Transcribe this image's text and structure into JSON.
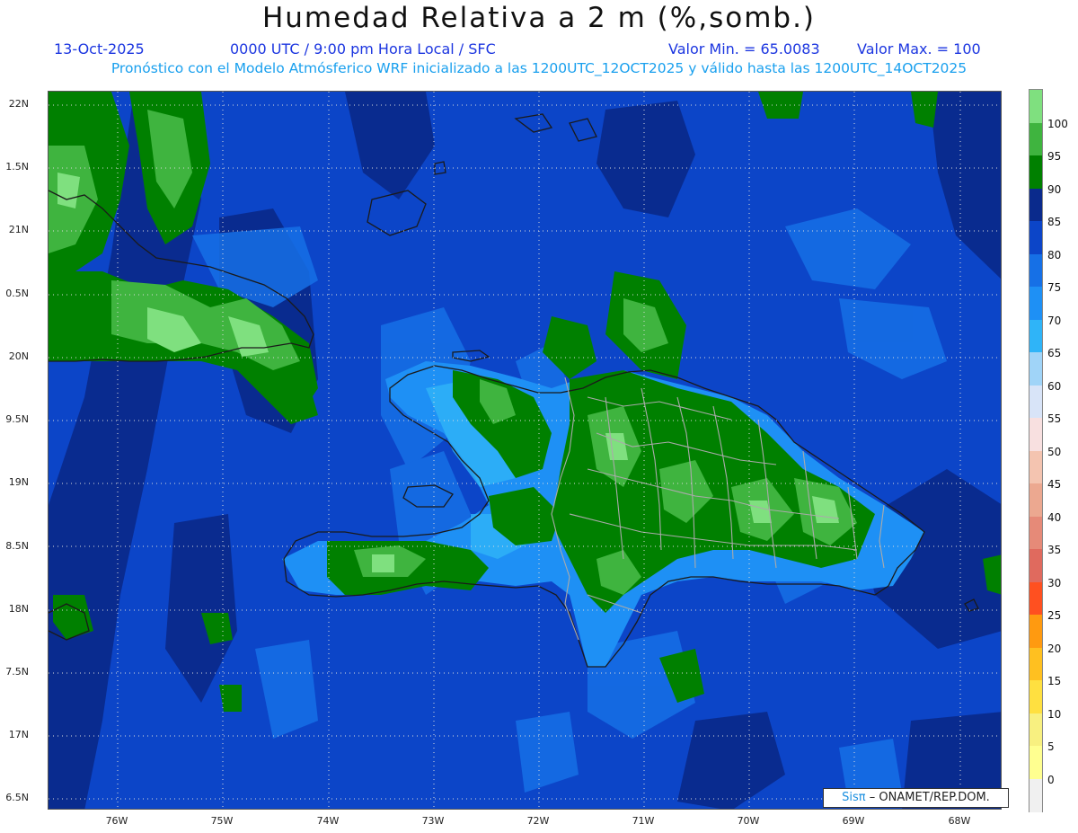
{
  "header": {
    "title": "Humedad Relativa a 2 m (%,somb.)",
    "date": "13-Oct-2025",
    "time": "0000 UTC / 9:00 pm Hora Local / SFC",
    "min_label": "Valor Min. = 65.0083",
    "max_label": "Valor Max. = 100",
    "description": "Pronóstico con el Modelo Atmósferico WRF inicializado a las 1200UTC_12OCT2025 y válido hasta las  1200UTC_14OCT2025"
  },
  "axes": {
    "lat_labels": [
      "22N",
      "1.5N",
      "21N",
      "0.5N",
      "20N",
      "9.5N",
      "19N",
      "8.5N",
      "18N",
      "7.5N",
      "17N",
      "6.5N"
    ],
    "lon_labels": [
      "76W",
      "75W",
      "74W",
      "73W",
      "72W",
      "71W",
      "70W",
      "69W",
      "68W"
    ]
  },
  "colorbar": {
    "labels": [
      "100",
      "95",
      "90",
      "85",
      "80",
      "75",
      "70",
      "65",
      "60",
      "55",
      "50",
      "45",
      "40",
      "35",
      "30",
      "25",
      "20",
      "15",
      "10",
      "5",
      "0"
    ],
    "colors": [
      "#7fe07f",
      "#3fb43f",
      "#008000",
      "#0a2a8c",
      "#0c45c8",
      "#1670e6",
      "#1e90f5",
      "#2fb4f8",
      "#a0d4f8",
      "#d8e4f8",
      "#f8e0e0",
      "#f4c4b0",
      "#eca890",
      "#e68a78",
      "#e06a5e",
      "#ff5020",
      "#ff9a10",
      "#ffc020",
      "#ffe040",
      "#f8f080",
      "#ffff90",
      "#f0f0f0"
    ]
  },
  "credit": {
    "sis": "Sisπ",
    "org": "– ONAMET/REP.DOM."
  },
  "colors": {
    "ocean": "#0c45c8",
    "ocean_dark": "#0a2a8c",
    "land_green": "#008000",
    "land_light": "#3fb43f",
    "land_lightest": "#7fe07f",
    "moist_blue": "#1670e6",
    "light_blue": "#2fb4f8"
  }
}
